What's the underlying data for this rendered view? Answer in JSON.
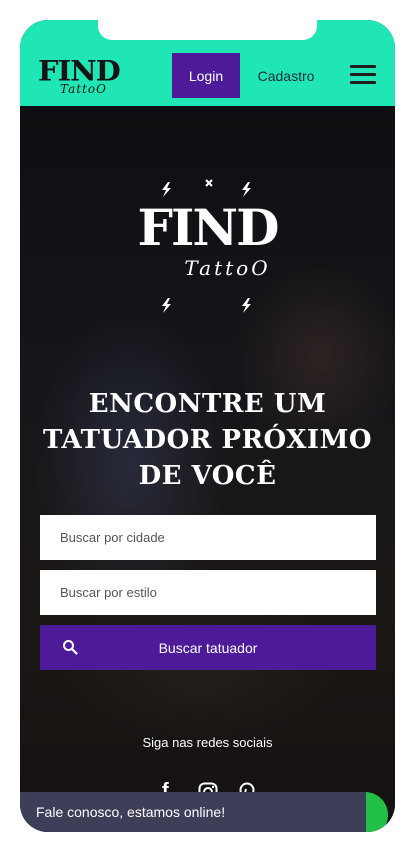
{
  "header": {
    "logo_top": "FIND",
    "logo_bottom": "TattoO",
    "login_label": "Login",
    "register_label": "Cadastro"
  },
  "hero": {
    "logo_top": "FIND",
    "logo_bottom": "TattoO",
    "headline_line1": "ENCONTRE UM",
    "headline_line2": "TATUADOR PRÓXIMO",
    "headline_line3": "DE VOCÊ"
  },
  "search": {
    "city_placeholder": "Buscar por cidade",
    "style_placeholder": "Buscar por estilo",
    "button_label": "Buscar tatuador"
  },
  "social": {
    "title": "Siga nas redes sociais",
    "icons": [
      "facebook-icon",
      "instagram-icon",
      "pinterest-icon"
    ]
  },
  "chat": {
    "label": "Fale conosco, estamos online!"
  },
  "colors": {
    "header_bg": "#1fe6b4",
    "accent": "#4d1a99",
    "chat_bg": "#3d3e58",
    "chat_dot": "#22c048"
  }
}
